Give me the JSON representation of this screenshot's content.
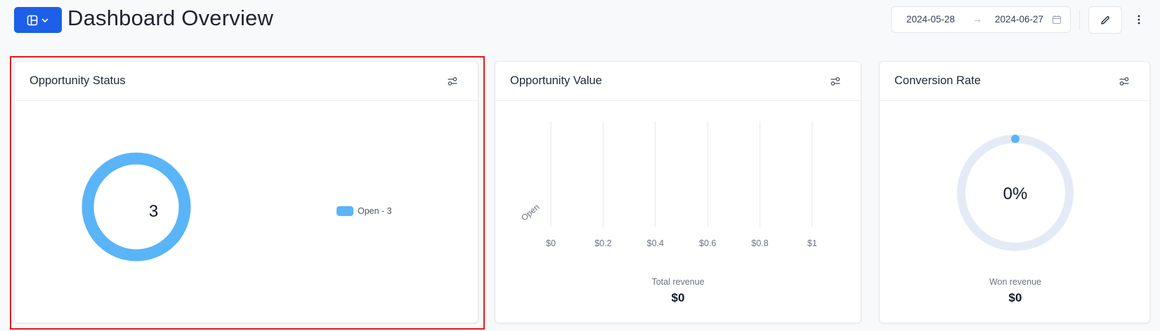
{
  "header": {
    "title": "Dashboard Overview",
    "date_start": "2024-05-28",
    "date_end": "2024-06-27",
    "arrow": "→"
  },
  "colors": {
    "accent": "#1d5fe8",
    "series": "#5ab4f8",
    "gauge_track": "#e4ebf7",
    "selection": "#e01c1c"
  },
  "cards": {
    "opportunity_status": {
      "title": "Opportunity Status",
      "center_value": "3",
      "legend": "Open - 3"
    },
    "opportunity_value": {
      "title": "Opportunity Value",
      "summary_label": "Total revenue",
      "summary_value": "$0"
    },
    "conversion_rate": {
      "title": "Conversion Rate",
      "center_value": "0%",
      "summary_label": "Won revenue",
      "summary_value": "$0"
    }
  },
  "chart_data": [
    {
      "type": "pie",
      "categories": [
        "Open"
      ],
      "values": [
        3
      ],
      "legend": [
        "Open - 3"
      ],
      "center_label": "3"
    },
    {
      "type": "bar",
      "orientation": "horizontal",
      "categories": [
        "Open"
      ],
      "values": [
        0
      ],
      "xlim": [
        0,
        1
      ],
      "xticks": [
        "$0",
        "$0.2",
        "$0.4",
        "$0.6",
        "$0.8",
        "$1"
      ],
      "grid": true
    },
    {
      "type": "gauge",
      "value": 0,
      "center_label": "0%"
    }
  ]
}
